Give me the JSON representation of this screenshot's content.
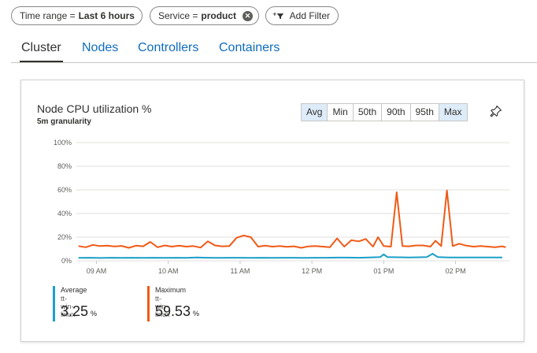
{
  "filters": {
    "time": {
      "label": "Time range = ",
      "value": "Last 6 hours"
    },
    "service": {
      "label": "Service = ",
      "value": "product"
    },
    "add_label": "Add Filter"
  },
  "tabs": [
    "Cluster",
    "Nodes",
    "Controllers",
    "Containers"
  ],
  "active_tab": "Cluster",
  "card": {
    "title": "Node CPU utilization %",
    "subtitle": "5m granularity",
    "aggregations": [
      "Avg",
      "Min",
      "50th",
      "90th",
      "95th",
      "Max"
    ],
    "selected_aggregations": [
      "Avg",
      "Max"
    ]
  },
  "colors": {
    "average": "#1b9fc7",
    "maximum": "#f05a16",
    "link": "#0f6cbd"
  },
  "legend": [
    {
      "name": "Average",
      "host": "tt-win-linux",
      "value": "3.25",
      "unit": "%"
    },
    {
      "name": "Maximum",
      "host": "tt-win-linux",
      "value": "59.53",
      "unit": "%"
    }
  ],
  "chart_data": {
    "type": "line",
    "y_ticks": [
      "100%",
      "80%",
      "60%",
      "40%",
      "20%",
      "0%"
    ],
    "ylim": [
      0,
      100
    ],
    "x_ticks": [
      {
        "label": "09 AM",
        "t": 9.0
      },
      {
        "label": "10 AM",
        "t": 10.0
      },
      {
        "label": "11 AM",
        "t": 11.0
      },
      {
        "label": "12 PM",
        "t": 12.0
      },
      {
        "label": "01 PM",
        "t": 13.0
      },
      {
        "label": "02 PM",
        "t": 14.0
      }
    ],
    "xlim": [
      8.72,
      14.75
    ],
    "grid": true,
    "series": [
      {
        "name": "Average",
        "color": "#1b9fc7",
        "values": [
          [
            8.75,
            2.5
          ],
          [
            8.9,
            2.6
          ],
          [
            9.05,
            2.4
          ],
          [
            9.2,
            2.6
          ],
          [
            9.35,
            2.5
          ],
          [
            9.5,
            2.6
          ],
          [
            9.65,
            2.5
          ],
          [
            9.8,
            2.6
          ],
          [
            9.95,
            2.5
          ],
          [
            10.1,
            2.6
          ],
          [
            10.25,
            2.5
          ],
          [
            10.4,
            2.8
          ],
          [
            10.55,
            2.6
          ],
          [
            10.7,
            2.5
          ],
          [
            10.85,
            2.6
          ],
          [
            11.0,
            2.6
          ],
          [
            11.15,
            2.5
          ],
          [
            11.3,
            2.6
          ],
          [
            11.45,
            2.5
          ],
          [
            11.6,
            2.6
          ],
          [
            11.75,
            2.6
          ],
          [
            11.9,
            2.5
          ],
          [
            12.05,
            2.6
          ],
          [
            12.2,
            2.6
          ],
          [
            12.35,
            2.7
          ],
          [
            12.5,
            2.7
          ],
          [
            12.65,
            2.6
          ],
          [
            12.8,
            2.9
          ],
          [
            12.95,
            3.1
          ],
          [
            13.0,
            5.5
          ],
          [
            13.05,
            3.2
          ],
          [
            13.2,
            3.0
          ],
          [
            13.35,
            2.9
          ],
          [
            13.5,
            3.0
          ],
          [
            13.6,
            3.2
          ],
          [
            13.68,
            6.0
          ],
          [
            13.75,
            3.2
          ],
          [
            13.9,
            2.9
          ],
          [
            14.05,
            2.9
          ],
          [
            14.2,
            2.8
          ],
          [
            14.35,
            2.8
          ],
          [
            14.5,
            2.8
          ],
          [
            14.65,
            2.8
          ]
        ]
      },
      {
        "name": "Maximum",
        "color": "#f05a16",
        "values": [
          [
            8.75,
            12.5
          ],
          [
            8.85,
            11.5
          ],
          [
            8.95,
            13.5
          ],
          [
            9.05,
            12.5
          ],
          [
            9.15,
            12.8
          ],
          [
            9.25,
            12.2
          ],
          [
            9.35,
            12.6
          ],
          [
            9.45,
            11.0
          ],
          [
            9.55,
            12.8
          ],
          [
            9.65,
            12.3
          ],
          [
            9.75,
            16.0
          ],
          [
            9.85,
            11.5
          ],
          [
            9.95,
            13.0
          ],
          [
            10.05,
            12.0
          ],
          [
            10.15,
            12.8
          ],
          [
            10.25,
            12.0
          ],
          [
            10.35,
            12.5
          ],
          [
            10.45,
            11.2
          ],
          [
            10.55,
            16.5
          ],
          [
            10.65,
            13.0
          ],
          [
            10.75,
            12.3
          ],
          [
            10.85,
            12.5
          ],
          [
            10.95,
            19.5
          ],
          [
            11.05,
            21.5
          ],
          [
            11.15,
            20.0
          ],
          [
            11.25,
            12.0
          ],
          [
            11.35,
            12.8
          ],
          [
            11.45,
            12.0
          ],
          [
            11.55,
            12.5
          ],
          [
            11.65,
            11.8
          ],
          [
            11.75,
            12.3
          ],
          [
            11.85,
            11.0
          ],
          [
            11.95,
            12.2
          ],
          [
            12.05,
            12.5
          ],
          [
            12.15,
            12.0
          ],
          [
            12.25,
            11.5
          ],
          [
            12.35,
            19.0
          ],
          [
            12.45,
            12.0
          ],
          [
            12.55,
            17.5
          ],
          [
            12.65,
            16.5
          ],
          [
            12.75,
            18.5
          ],
          [
            12.85,
            12.0
          ],
          [
            12.92,
            20.0
          ],
          [
            13.0,
            12.5
          ],
          [
            13.1,
            12.0
          ],
          [
            13.18,
            58.0
          ],
          [
            13.26,
            12.5
          ],
          [
            13.35,
            12.3
          ],
          [
            13.45,
            13.0
          ],
          [
            13.55,
            13.0
          ],
          [
            13.65,
            12.0
          ],
          [
            13.72,
            17.0
          ],
          [
            13.8,
            12.5
          ],
          [
            13.88,
            59.53
          ],
          [
            13.96,
            12.5
          ],
          [
            14.05,
            14.5
          ],
          [
            14.15,
            12.8
          ],
          [
            14.25,
            12.0
          ],
          [
            14.35,
            12.5
          ],
          [
            14.45,
            12.0
          ],
          [
            14.55,
            11.5
          ],
          [
            14.65,
            12.3
          ],
          [
            14.7,
            11.5
          ]
        ]
      }
    ]
  }
}
